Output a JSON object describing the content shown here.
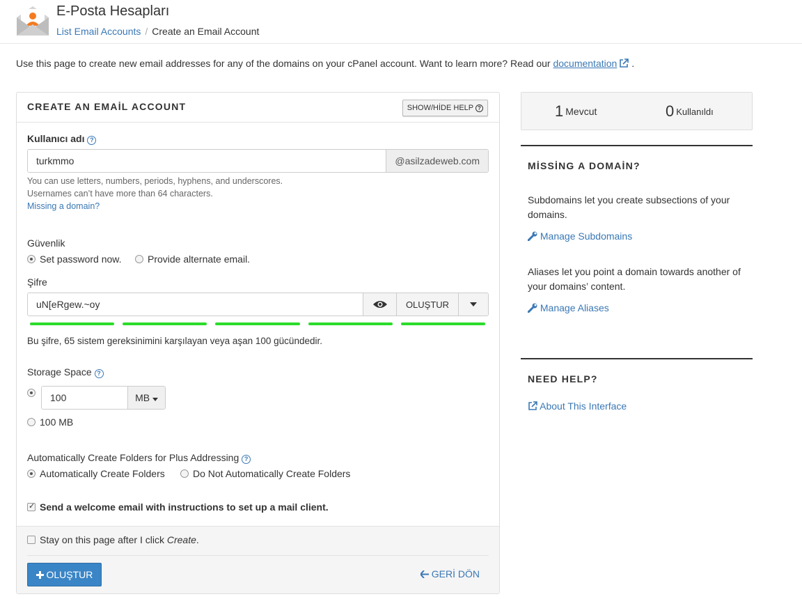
{
  "header": {
    "title": "E-Posta Hesapları",
    "breadcrumb_link": "List Email Accounts",
    "breadcrumb_current": "Create an Email Account"
  },
  "intro": {
    "text": "Use this page to create new email addresses for any of the domains on your cPanel account. Want to learn more? Read our",
    "link": "documentation",
    "end": "."
  },
  "form": {
    "panel_title": "CREATE AN EMAİL ACCOUNT",
    "help_toggle": "SHOW/HİDE HELP",
    "username": {
      "label": "Kullanıcı adı",
      "value": "turkmmo",
      "domain": "@asilzadeweb.com",
      "help1": "You can use letters, numbers, periods, hyphens, and underscores.",
      "help2": "Usernames can’t have more than 64 characters.",
      "missing_link": "Missing a domain?"
    },
    "security": {
      "label": "Güvenlik",
      "option1": "Set password now.",
      "option2": "Provide alternate email."
    },
    "password": {
      "label": "Şifre",
      "value": "uN[eRgew.~oy",
      "generate": "OLUŞTUR",
      "strength_text": "Bu şifre, 65 sistem gereksinimini karşılayan veya aşan 100 gücündedir.",
      "strength": 100
    },
    "storage": {
      "label": "Storage Space",
      "value": "100",
      "unit": "MB",
      "option2": "100 MB"
    },
    "plus": {
      "label": "Automatically Create Folders for Plus Addressing",
      "option1": "Automatically Create Folders",
      "option2": "Do Not Automatically Create Folders"
    },
    "welcome": "Send a welcome email with instructions to set up a mail client.",
    "stay_text": "Stay on this page after I click",
    "stay_em": "Create",
    "stay_end": ".",
    "create_button": "OLUŞTUR",
    "back": "GERİ DÖN"
  },
  "stats": {
    "available_count": "1",
    "available_label": "Mevcut",
    "used_count": "0",
    "used_label": "Kullanıldı"
  },
  "sidebar": {
    "missing_title": "MİSSİNG A DOMAİN?",
    "subdomains_text": "Subdomains let you create subsections of your domains.",
    "manage_subdomains": "Manage Subdomains",
    "aliases_text": "Aliases let you point a domain towards another of your domains’ content.",
    "manage_aliases": "Manage Aliases",
    "help_title": "NEED HELP?",
    "about": "About This Interface"
  },
  "colors": {
    "accent": "#3a85c6",
    "link": "#3a78b5",
    "strength": "#2bdc2b"
  }
}
